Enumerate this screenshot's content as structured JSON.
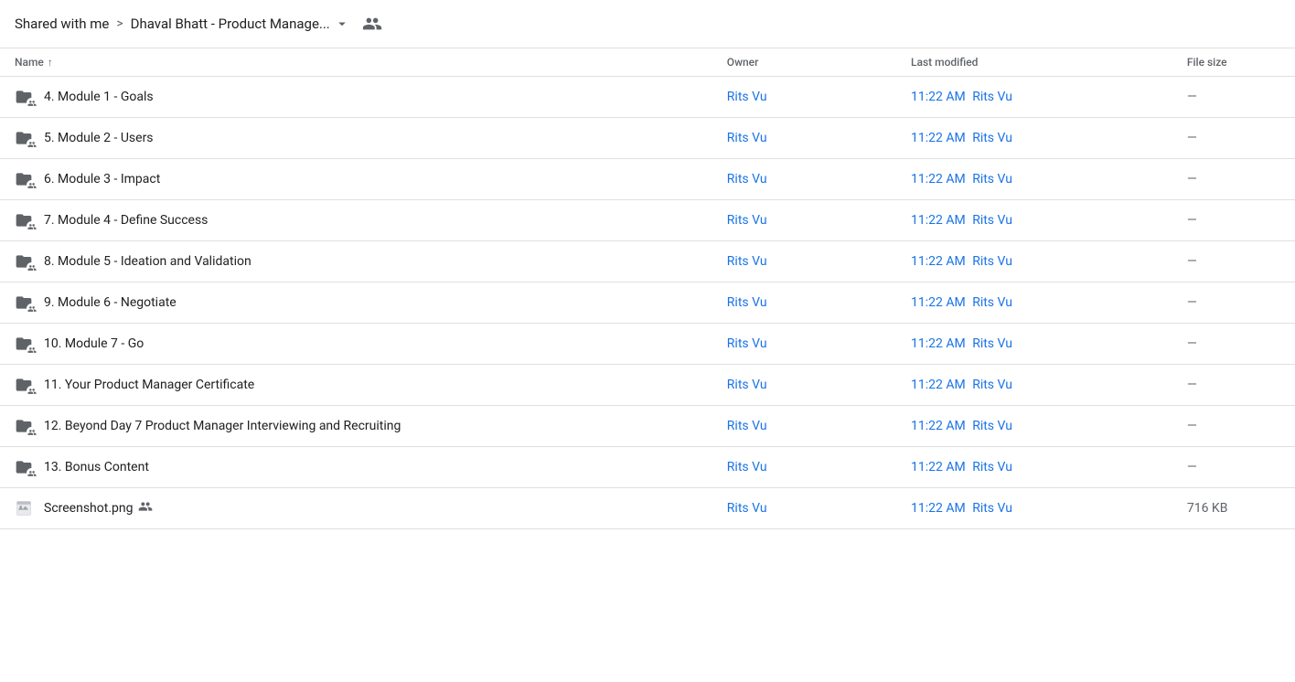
{
  "breadcrumb": {
    "shared_label": "Shared with me",
    "separator": ">",
    "current_folder": "Dhaval Bhatt - Product Manage...",
    "people_icon": "people-icon"
  },
  "table": {
    "columns": {
      "name": "Name",
      "owner": "Owner",
      "last_modified": "Last modified",
      "file_size": "File size"
    },
    "rows": [
      {
        "id": 1,
        "name": "4. Module 1 - Goals",
        "type": "folder",
        "owner": "Rits Vu",
        "modified_time": "11:22 AM",
        "modified_user": "Rits Vu",
        "size": "—"
      },
      {
        "id": 2,
        "name": "5. Module 2 - Users",
        "type": "folder",
        "owner": "Rits Vu",
        "modified_time": "11:22 AM",
        "modified_user": "Rits Vu",
        "size": "—"
      },
      {
        "id": 3,
        "name": "6. Module 3 - Impact",
        "type": "folder",
        "owner": "Rits Vu",
        "modified_time": "11:22 AM",
        "modified_user": "Rits Vu",
        "size": "—"
      },
      {
        "id": 4,
        "name": "7. Module 4 - Define Success",
        "type": "folder",
        "owner": "Rits Vu",
        "modified_time": "11:22 AM",
        "modified_user": "Rits Vu",
        "size": "—"
      },
      {
        "id": 5,
        "name": "8. Module 5 - Ideation and Validation",
        "type": "folder",
        "owner": "Rits Vu",
        "modified_time": "11:22 AM",
        "modified_user": "Rits Vu",
        "size": "—"
      },
      {
        "id": 6,
        "name": "9. Module 6 - Negotiate",
        "type": "folder",
        "owner": "Rits Vu",
        "modified_time": "11:22 AM",
        "modified_user": "Rits Vu",
        "size": "—"
      },
      {
        "id": 7,
        "name": "10. Module 7 - Go",
        "type": "folder",
        "owner": "Rits Vu",
        "modified_time": "11:22 AM",
        "modified_user": "Rits Vu",
        "size": "—"
      },
      {
        "id": 8,
        "name": "11. Your Product Manager Certificate",
        "type": "folder",
        "owner": "Rits Vu",
        "modified_time": "11:22 AM",
        "modified_user": "Rits Vu",
        "size": "—"
      },
      {
        "id": 9,
        "name": "12. Beyond Day 7 Product Manager Interviewing and Recruiting",
        "type": "folder",
        "owner": "Rits Vu",
        "modified_time": "11:22 AM",
        "modified_user": "Rits Vu",
        "size": "—"
      },
      {
        "id": 10,
        "name": "13. Bonus Content",
        "type": "folder",
        "owner": "Rits Vu",
        "modified_time": "11:22 AM",
        "modified_user": "Rits Vu",
        "size": "—"
      },
      {
        "id": 11,
        "name": "Screenshot.png",
        "type": "image",
        "owner": "Rits Vu",
        "modified_time": "11:22 AM",
        "modified_user": "Rits Vu",
        "size": "716 KB"
      }
    ]
  }
}
